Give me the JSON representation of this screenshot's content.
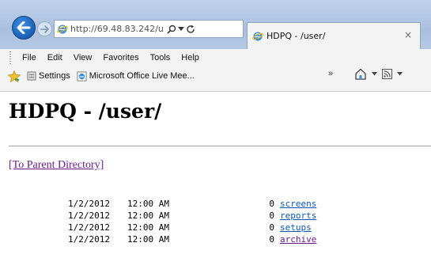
{
  "browser": {
    "address_url_host": "http://69.48.83.242",
    "address_url_rest": "/user",
    "tab_title": "HDPQ - /user/",
    "menu": [
      "File",
      "Edit",
      "View",
      "Favorites",
      "Tools",
      "Help"
    ],
    "favorites": [
      {
        "label": "Settings",
        "icon": "settings-page-icon"
      },
      {
        "label": "Microsoft Office Live Mee...",
        "icon": "ie-page-icon"
      }
    ],
    "chevron": "»",
    "tab_close": "×"
  },
  "page": {
    "title": "HDPQ - /user/",
    "parent_link": "[To Parent Directory]",
    "entries": [
      {
        "date": "1/2/2012",
        "time": "12:00 AM",
        "size": "0",
        "name": "screens",
        "visited": false
      },
      {
        "date": "1/2/2012",
        "time": "12:00 AM",
        "size": "0",
        "name": "reports",
        "visited": false
      },
      {
        "date": "1/2/2012",
        "time": "12:00 AM",
        "size": "0",
        "name": "setups",
        "visited": false
      },
      {
        "date": "1/2/2012",
        "time": "12:00 AM",
        "size": "0",
        "name": "archive",
        "visited": true
      }
    ]
  },
  "colors": {
    "link": "#0b55b7",
    "visited_link": "#6a1b8a",
    "titlebar": "#b4c8e3"
  }
}
